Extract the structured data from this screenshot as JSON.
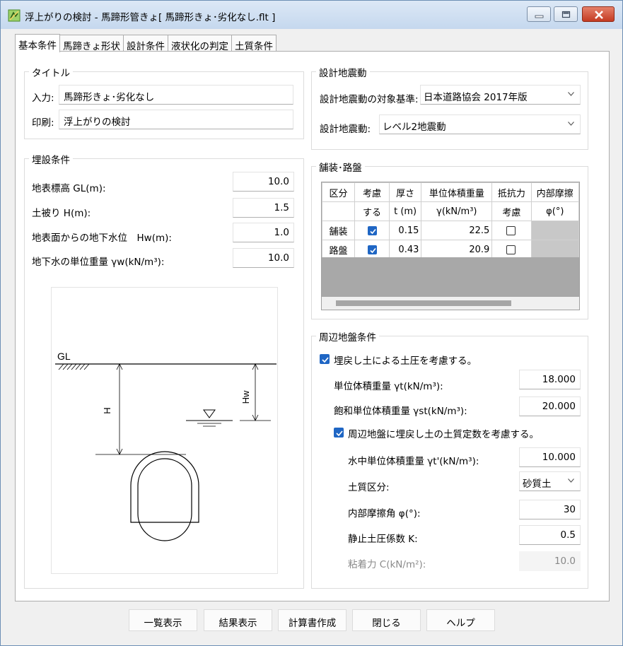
{
  "window": {
    "title": "浮上がりの検討 - 馬蹄形管きょ[ 馬蹄形きょ･劣化なし.flt ]",
    "app_icon": "document-check-icon",
    "controls": {
      "minimize_icon": "minimize-icon",
      "maximize_icon": "maximize-icon",
      "close_icon": "close-icon"
    }
  },
  "tabs": [
    {
      "label": "基本条件",
      "active": true
    },
    {
      "label": "馬蹄きょ形状",
      "active": false
    },
    {
      "label": "設計条件",
      "active": false
    },
    {
      "label": "液状化の判定",
      "active": false
    },
    {
      "label": "土質条件",
      "active": false
    }
  ],
  "title_group": {
    "heading": "タイトル",
    "input_label": "入力:",
    "input_value": "馬蹄形きょ･劣化なし",
    "print_label": "印刷:",
    "print_value": "浮上がりの検討"
  },
  "burial": {
    "heading": "埋設条件",
    "rows": [
      {
        "label": "地表標高 GL(m):",
        "value": "10.0"
      },
      {
        "label": "土被り H(m):",
        "value": "1.5"
      },
      {
        "label": "地表面からの地下水位　Hw(m):",
        "value": "1.0"
      },
      {
        "label": "地下水の単位重量 γw(kN/m³):",
        "value": "10.0"
      }
    ]
  },
  "diagram": {
    "gl_label": "GL",
    "h_label": "H",
    "hw_label": "Hw"
  },
  "seismic": {
    "heading": "設計地震動",
    "standard_label": "設計地震動の対象基準:",
    "standard_value": "日本道路協会 2017年版",
    "motion_label": "設計地震動:",
    "motion_value": "レベル2地震動"
  },
  "pavement": {
    "heading": "舗装･路盤",
    "header1": [
      "区分",
      "考慮",
      "厚さ",
      "単位体積重量",
      "抵抗力",
      "内部摩擦"
    ],
    "header2": [
      "",
      "する",
      "t (m)",
      "γ(kN/m³)",
      "考慮",
      "φ(°)"
    ],
    "rows": [
      {
        "name": "舗装",
        "consider": true,
        "t": "0.15",
        "gamma": "22.5",
        "resist": false
      },
      {
        "name": "路盤",
        "consider": true,
        "t": "0.43",
        "gamma": "20.9",
        "resist": false
      }
    ]
  },
  "surrounding": {
    "heading": "周辺地盤条件",
    "backfill_check_label": "埋戻し土による土圧を考慮する。",
    "backfill_checked": true,
    "unit_weight_label": "単位体積重量 γt(kN/m³):",
    "unit_weight_value": "18.000",
    "sat_weight_label": "飽和単位体積重量 γst(kN/m³):",
    "sat_weight_value": "20.000",
    "soil_const_check_label": "周辺地盤に埋戻し土の土質定数を考慮する。",
    "soil_const_checked": true,
    "sub_weight_label": "水中単位体積重量 γt'(kN/m³):",
    "sub_weight_value": "10.000",
    "soil_type_label": "土質区分:",
    "soil_type_value": "砂質土",
    "friction_label": "内部摩擦角 φ(°):",
    "friction_value": "30",
    "k_label": "静止土圧係数 K:",
    "k_value": "0.5",
    "cohesion_label": "粘着力 C(kN/m²):",
    "cohesion_value": "10.0"
  },
  "buttons": [
    "一覧表示",
    "結果表示",
    "計算書作成",
    "閉じる",
    "ヘルプ"
  ]
}
